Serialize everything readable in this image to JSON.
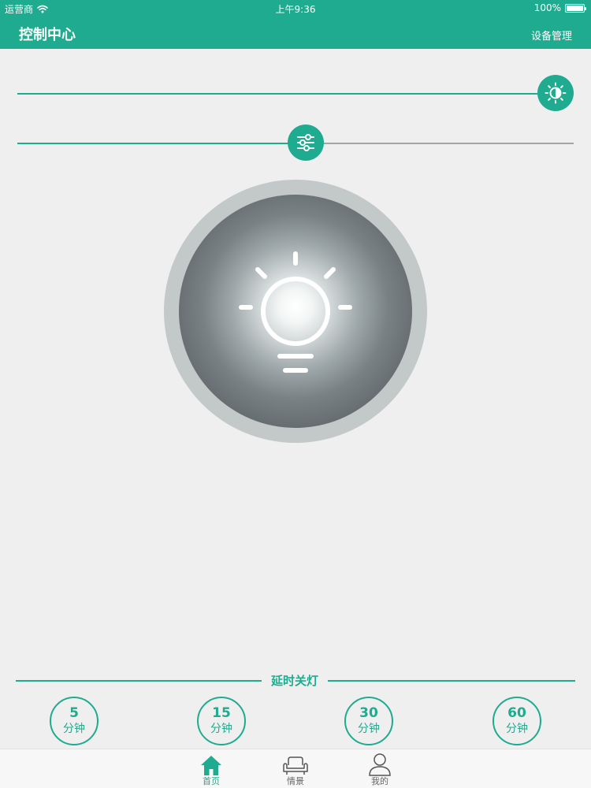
{
  "status_bar": {
    "carrier": "运营商",
    "time": "上午9:36",
    "battery": "100%",
    "battery_level": 1.0
  },
  "nav": {
    "title": "控制中心",
    "right_action": "设备管理"
  },
  "sliders": {
    "brightness": {
      "icon": "brightness-icon",
      "value": 1.0
    },
    "color_temperature": {
      "icon": "sliders-icon",
      "value": 0.52
    }
  },
  "lamp": {
    "icon": "lightbulb-icon"
  },
  "timer": {
    "title": "延时关灯",
    "options": [
      {
        "value": "5",
        "unit": "分钟"
      },
      {
        "value": "15",
        "unit": "分钟"
      },
      {
        "value": "30",
        "unit": "分钟"
      },
      {
        "value": "60",
        "unit": "分钟"
      }
    ]
  },
  "tabbar": {
    "items": [
      {
        "label": "首页",
        "icon": "home-icon",
        "active": true
      },
      {
        "label": "情景",
        "icon": "sofa-icon",
        "active": false
      },
      {
        "label": "我的",
        "icon": "user-icon",
        "active": false
      }
    ]
  },
  "colors": {
    "accent": "#1fab8f",
    "background": "#efefef",
    "track_inactive": "#a5a5a5"
  }
}
